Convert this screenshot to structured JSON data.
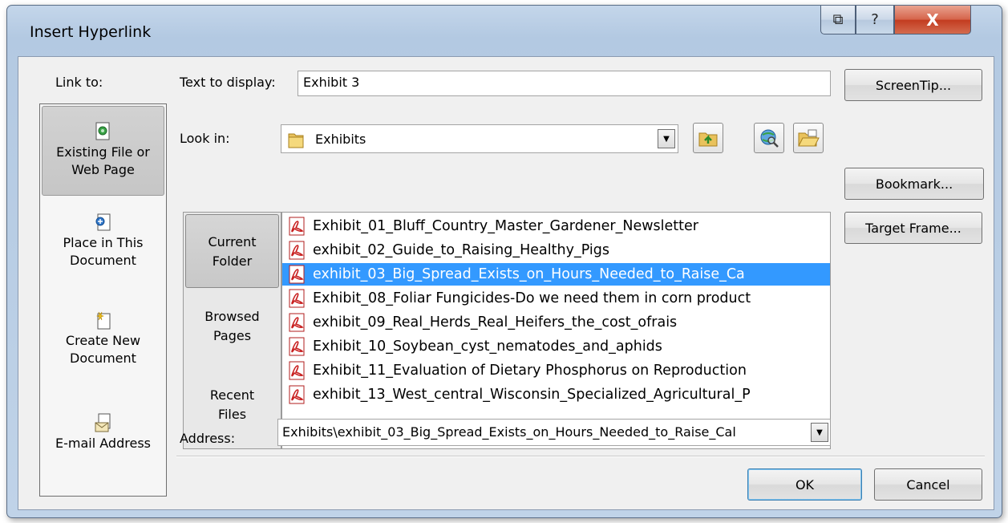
{
  "window": {
    "title": "Insert Hyperlink",
    "restore_glyph": "⧉",
    "help_glyph": "?",
    "close_glyph": "X"
  },
  "link_to": {
    "label": "Link to:",
    "items": [
      {
        "line1": "Existing File or",
        "line2": "Web Page",
        "icon": "existing-file-icon",
        "selected": true
      },
      {
        "line1": "Place in This",
        "line2": "Document",
        "icon": "place-in-document-icon"
      },
      {
        "line1": "Create New",
        "line2": "Document",
        "icon": "new-document-icon"
      },
      {
        "line1": "E-mail Address",
        "line2": "",
        "icon": "email-icon"
      }
    ]
  },
  "text_to_display": {
    "label": "Text to display:",
    "value": "Exhibit 3"
  },
  "look_in": {
    "label": "Look in:",
    "value": "Exhibits",
    "dropdown_glyph": "▼"
  },
  "nav_tabs": [
    {
      "line1": "Current",
      "line2": "Folder",
      "selected": true
    },
    {
      "line1": "Browsed",
      "line2": "Pages"
    },
    {
      "line1": "Recent",
      "line2": "Files"
    }
  ],
  "files": [
    "Exhibit_01_Bluff_Country_Master_Gardener_Newsletter",
    "exhibit_02_Guide_to_Raising_Healthy_Pigs",
    "exhibit_03_Big_Spread_Exists_on_Hours_Needed_to_Raise_Ca",
    "Exhibit_08_Foliar Fungicides-Do we need them in corn product",
    "exhibit_09_Real_Herds_Real_Heifers_the_cost_ofrais",
    "Exhibit_10_Soybean_cyst_nematodes_and_aphids",
    "Exhibit_11_Evaluation of Dietary Phosphorus on Reproduction",
    "exhibit_13_West_central_Wisconsin_Specialized_Agricultural_P"
  ],
  "selected_file_index": 2,
  "address": {
    "label": "Address:",
    "value": "Exhibits\\exhibit_03_Big_Spread_Exists_on_Hours_Needed_to_Raise_Cal"
  },
  "buttons": {
    "screentip": "ScreenTip...",
    "bookmark": "Bookmark...",
    "target_frame": "Target Frame...",
    "ok": "OK",
    "cancel": "Cancel"
  },
  "colors": {
    "selection": "#3399ff",
    "title_bar": "#b9cde5",
    "close_button": "#c7432a"
  }
}
